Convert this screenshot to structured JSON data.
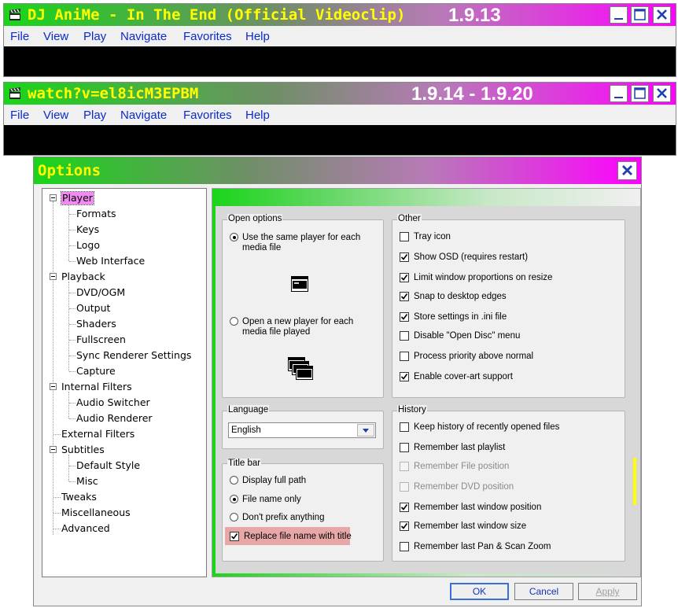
{
  "player_window_1": {
    "title": "DJ AniMe - In The End (Official Videoclip)",
    "version": "1.9.13",
    "menu": [
      "File",
      "View",
      "Play",
      "Navigate",
      "Favorites",
      "Help"
    ]
  },
  "player_window_2": {
    "title": "watch?v=el8icM3EPBM",
    "version": "1.9.14 - 1.9.20",
    "menu": [
      "File",
      "View",
      "Play",
      "Navigate",
      "Favorites",
      "Help"
    ]
  },
  "options": {
    "title": "Options",
    "tree": [
      {
        "label": "Player",
        "level": 0,
        "expanded": true,
        "selected": true
      },
      {
        "label": "Formats",
        "level": 1
      },
      {
        "label": "Keys",
        "level": 1
      },
      {
        "label": "Logo",
        "level": 1
      },
      {
        "label": "Web Interface",
        "level": 1
      },
      {
        "label": "Playback",
        "level": 0,
        "expanded": true
      },
      {
        "label": "DVD/OGM",
        "level": 1
      },
      {
        "label": "Output",
        "level": 1
      },
      {
        "label": "Shaders",
        "level": 1
      },
      {
        "label": "Fullscreen",
        "level": 1
      },
      {
        "label": "Sync Renderer Settings",
        "level": 1
      },
      {
        "label": "Capture",
        "level": 1
      },
      {
        "label": "Internal Filters",
        "level": 0,
        "expanded": true
      },
      {
        "label": "Audio Switcher",
        "level": 1
      },
      {
        "label": "Audio Renderer",
        "level": 1
      },
      {
        "label": "External Filters",
        "level": 0
      },
      {
        "label": "Subtitles",
        "level": 0,
        "expanded": true
      },
      {
        "label": "Default Style",
        "level": 1
      },
      {
        "label": "Misc",
        "level": 1
      },
      {
        "label": "Tweaks",
        "level": 0
      },
      {
        "label": "Miscellaneous",
        "level": 0
      },
      {
        "label": "Advanced",
        "level": 0
      }
    ],
    "open_options": {
      "label": "Open options",
      "same_player": {
        "label": "Use the same player for each media file",
        "selected": true
      },
      "new_player": {
        "label": "Open a new player for each media file played",
        "selected": false
      }
    },
    "other": {
      "label": "Other",
      "items": [
        {
          "label": "Tray icon",
          "checked": false
        },
        {
          "label": "Show OSD (requires restart)",
          "checked": true
        },
        {
          "label": "Limit window proportions on resize",
          "checked": true
        },
        {
          "label": "Snap to desktop edges",
          "checked": true
        },
        {
          "label": "Store settings in .ini file",
          "checked": true
        },
        {
          "label": "Disable \"Open Disc\" menu",
          "checked": false
        },
        {
          "label": "Process priority above normal",
          "checked": false
        },
        {
          "label": "Enable cover-art support",
          "checked": true
        }
      ]
    },
    "language": {
      "label": "Language",
      "value": "English"
    },
    "title_bar": {
      "label": "Title bar",
      "full_path": {
        "label": "Display full path",
        "selected": false
      },
      "file_name_only": {
        "label": "File name only",
        "selected": true
      },
      "no_prefix": {
        "label": "Don't prefix anything",
        "selected": false
      },
      "replace_name": {
        "label": "Replace file name with title",
        "checked": true
      }
    },
    "history": {
      "label": "History",
      "items": [
        {
          "label": "Keep history of recently opened files",
          "checked": false,
          "disabled": false
        },
        {
          "label": "Remember last playlist",
          "checked": false,
          "disabled": false
        },
        {
          "label": "Remember File position",
          "checked": false,
          "disabled": true
        },
        {
          "label": "Remember DVD position",
          "checked": false,
          "disabled": true
        },
        {
          "label": "Remember last window position",
          "checked": true,
          "disabled": false
        },
        {
          "label": "Remember last window size",
          "checked": true,
          "disabled": false
        },
        {
          "label": "Remember last Pan & Scan Zoom",
          "checked": false,
          "disabled": false
        }
      ]
    },
    "buttons": {
      "ok": "OK",
      "cancel": "Cancel",
      "apply": "Apply"
    }
  },
  "colors": {
    "title_gradient_start": "#1ad51a",
    "title_gradient_end": "#ff00ff",
    "title_text": "#ffff00",
    "menu_text": "#0a2ad0",
    "tree_selection": "#f38af3",
    "highlight": "#e8a7a7"
  },
  "icons": {
    "app": "film-clapper-icon",
    "minimize": "minimize-icon",
    "maximize": "maximize-icon",
    "close": "close-icon"
  }
}
